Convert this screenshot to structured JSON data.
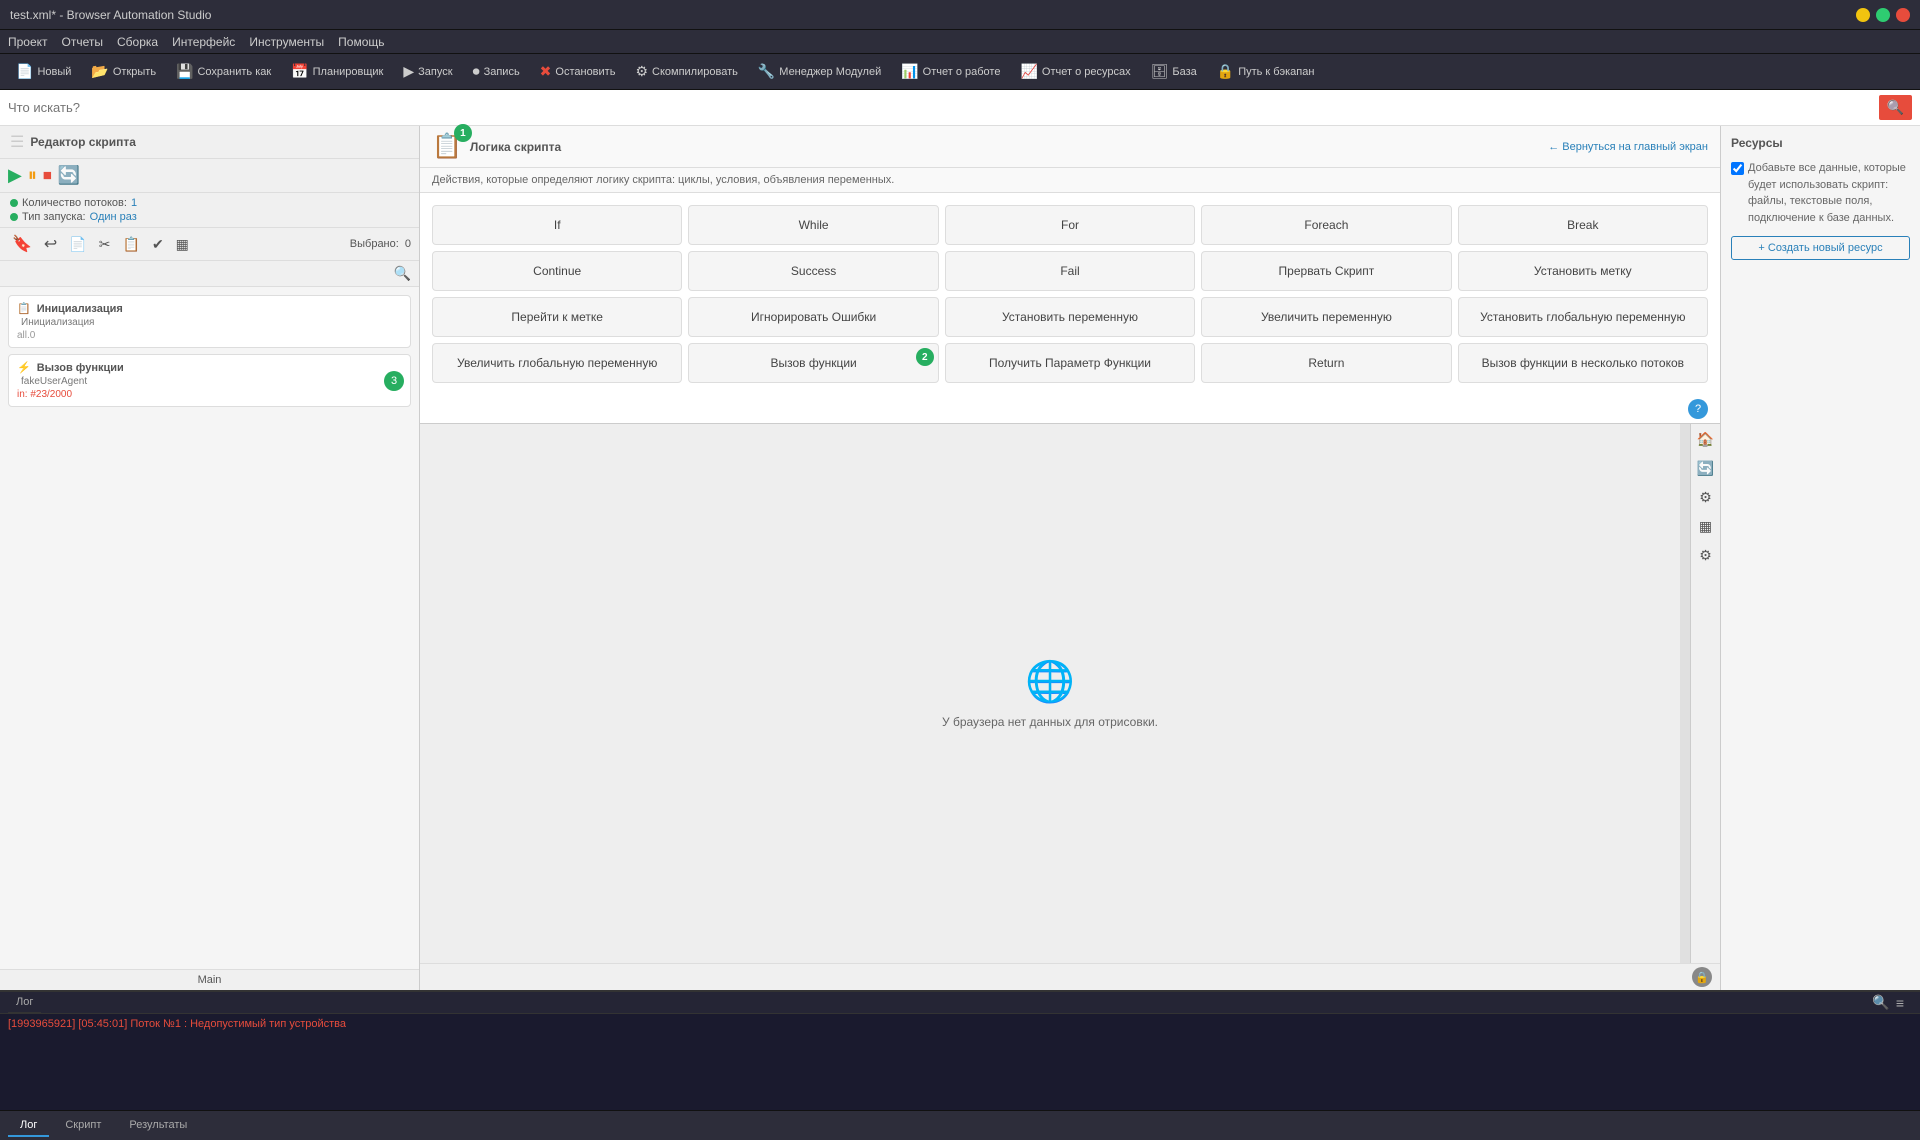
{
  "window": {
    "title": "test.xml* - Browser Automation Studio"
  },
  "menu": {
    "items": [
      "Проект",
      "Отчеты",
      "Сборка",
      "Интерфейс",
      "Инструменты",
      "Помощь"
    ]
  },
  "toolbar": {
    "buttons": [
      {
        "label": "Новый",
        "icon": "📄"
      },
      {
        "label": "Открыть",
        "icon": "📂"
      },
      {
        "label": "Сохранить как",
        "icon": "💾"
      },
      {
        "label": "Планировщик",
        "icon": "📅"
      },
      {
        "label": "Запуск",
        "icon": "⏺"
      },
      {
        "label": "Запись",
        "icon": "⏺"
      },
      {
        "label": "Остановить",
        "icon": "✖"
      },
      {
        "label": "Скомпилировать",
        "icon": "⚙"
      },
      {
        "label": "Менеджер Модулей",
        "icon": "🔧"
      },
      {
        "label": "Отчет о работе",
        "icon": "📊"
      },
      {
        "label": "Отчет о ресурсах",
        "icon": "📈"
      },
      {
        "label": "База",
        "icon": "🗄"
      },
      {
        "label": "Путь к бэкапан",
        "icon": "🔒"
      }
    ]
  },
  "search": {
    "placeholder": "Что искать?"
  },
  "left_panel": {
    "title": "Редактор скрипта",
    "info": {
      "threads_label": "Количество потоков:",
      "threads_value": "1",
      "launch_label": "Тип запуска:",
      "launch_value": "Один раз"
    },
    "selected_label": "Выбрано:",
    "selected_value": "0",
    "items": [
      {
        "type": "Инициализация",
        "name": "Инициализация",
        "id": "init",
        "badge": null,
        "extra": "all.0"
      },
      {
        "type": "Вызов функции",
        "name": "fakeUserAgent",
        "id": "func",
        "badge": "3",
        "extra": "in: #23/2000",
        "error": null
      }
    ],
    "footer": "Main"
  },
  "logic_panel": {
    "title": "Логика скрипта",
    "back_label": "← Вернуться на главный экран",
    "description": "Действия, которые определяют логику скрипта: циклы, условия, объявления переменных.",
    "badge_number": "1",
    "actions": [
      {
        "label": "If",
        "row": 0,
        "col": 0
      },
      {
        "label": "While",
        "row": 0,
        "col": 1
      },
      {
        "label": "For",
        "row": 0,
        "col": 2
      },
      {
        "label": "Foreach",
        "row": 0,
        "col": 3
      },
      {
        "label": "Break",
        "row": 0,
        "col": 4
      },
      {
        "label": "Continue",
        "row": 1,
        "col": 0
      },
      {
        "label": "Success",
        "row": 1,
        "col": 1
      },
      {
        "label": "Fail",
        "row": 1,
        "col": 2
      },
      {
        "label": "Прервать Скрипт",
        "row": 1,
        "col": 3
      },
      {
        "label": "Установить метку",
        "row": 1,
        "col": 4
      },
      {
        "label": "Перейти к метке",
        "row": 2,
        "col": 0
      },
      {
        "label": "Игнорировать Ошибки",
        "row": 2,
        "col": 1
      },
      {
        "label": "Установить переменную",
        "row": 2,
        "col": 2
      },
      {
        "label": "Увеличить переменную",
        "row": 2,
        "col": 3
      },
      {
        "label": "Установить глобальную переменную",
        "row": 2,
        "col": 4
      },
      {
        "label": "Увеличить глобальную переменную",
        "row": 3,
        "col": 0
      },
      {
        "label": "Вызов функции",
        "row": 3,
        "col": 1
      },
      {
        "label": "Получить Параметр Функции",
        "row": 3,
        "col": 2
      },
      {
        "label": "Return",
        "row": 3,
        "col": 3
      },
      {
        "label": "Вызов функции в несколько потоков",
        "row": 3,
        "col": 4
      }
    ],
    "call_func_badge": "2"
  },
  "browser": {
    "no_data_text": "У браузера нет данных для отрисовки."
  },
  "resources": {
    "title": "Ресурсы",
    "description": "Добавьте все данные, которые будет использовать скрипт: файлы, текстовые поля, подключение к базе данных.",
    "create_btn": "+ Создать новый ресурс"
  },
  "log": {
    "title": "Лог",
    "entry": "[1993965921] [05:45:01] Поток №1 : Недопустимый тип устройства"
  },
  "bottom_tabs": [
    {
      "label": "Лог",
      "active": true
    },
    {
      "label": "Скрипт",
      "active": false
    },
    {
      "label": "Результаты",
      "active": false
    }
  ]
}
